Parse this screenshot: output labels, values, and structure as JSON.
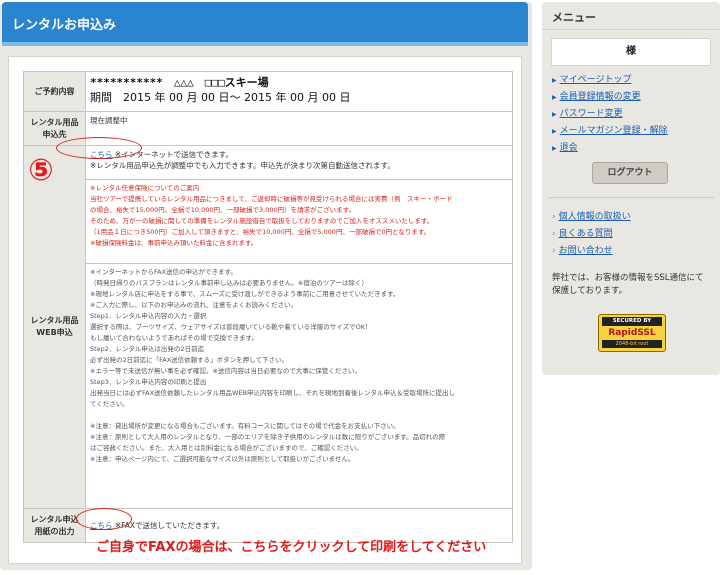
{
  "main": {
    "title": "レンタルお申込み",
    "reservation": {
      "label": "ご予約内容",
      "line1": "***********　△△△　□□□スキー場",
      "line2": "期間　2015 年 00 月 00 日～ 2015 年 00 月 00 日"
    },
    "delivery": {
      "label_1": "レンタル用品",
      "label_2": "申込先",
      "value": "現在調整中"
    },
    "web_apply": {
      "label_1": "レンタル用品",
      "label_2": "WEB申込",
      "link": "こちら",
      "link_after": " ※インターネットで送信できます。",
      "note2": "※レンタル用品申込先が調整中でも入力できます。申込先が決まり次第自動送信されます。",
      "insurance": [
        "※レンタル任意保険についてのご案内",
        "当社ツアーで提携しているレンタル用品につきまして、ご返却時に破損等が見受けられる場合には実費（例　スキー・ボード",
        "の場合、裕失で15,000円、全損で10,000円、一部破損で3,000円）を請求がございます。",
        "そのため、万が一の破損に関しての準備をレンタル施設借自で取扱をしておりますのでご加入をオススメいたします。",
        "（1用品１日につき500円）ご加入して頂きますと、裕失で10,000円、全損で5,000円、一部破損で0円となります。",
        "※破損保険料金は、事前申込み頂いた料金に含まれます。"
      ],
      "instructions": [
        "※インターネットからFAX送信の申込ができます。",
        "（時発日帰りのバスプランはレンタル事前申し込みは必要ありません。※宿泊のツアーは除く）",
        "※現地レンタル店に申込をする事で、スムーズに受け渡しができるよう事前にご用意させていただきます。",
        "※ご入力に際し、以下のお申込みの流れ、注意をよくお読みください。",
        "Step1．レンタル申込内容の入力・選択",
        "選択する際は、ブーツサイズ、ウェアサイズは普段履いている靴や着ている洋服のサイズでOK！",
        "もし履いて合わないようであればその場で交換できます。",
        "Step2．レンタル申込は出発の2日前迄",
        "必ず出発の2日前迄に「FAX送信依頼する」ボタンを押して下さい。",
        "※エラー等で未送信が無い事を必ず確認。※送信内容は当日必要なので大事に保管ください。",
        "Step3．レンタル申込内容の印刷と提出",
        "出発当日には必ずFAX送信依頼したレンタル用品WEB申込内容を印刷し、それを現地到着後レンタル申込＆受取場所に提出し",
        "てください。",
        "",
        "※注意：貸出場所が変更になる場合もございます。有料コースに関してはその場で代金をお支払い下さい。",
        "※注意：原則として大人用のレンタルとなり、一部のエリアを除き子供用のレンタルは数に限りがございます。品切れの際",
        "はご容赦ください。また、大人用とは別料金になる場合がございますので、ご確認ください。",
        "※注意：申込ページ内にて、ご選択可能なサイズ以外は原則として取扱いがございません。"
      ]
    },
    "fax_output": {
      "label_1": "レンタル申込",
      "label_2": "用紙の出力",
      "link": "こちら",
      "text": " ※FAXで送信していただきます。"
    },
    "annotation_number": "⑤",
    "bottom_instruction": "ご自身でFAXの場合は、こちらをクリックして印刷をしてください"
  },
  "sidebar": {
    "title": "メニュー",
    "user": "様",
    "links": [
      "マイページトップ",
      "会員登録情報の変更",
      "パスワード変更",
      "メールマガジン登録・解除",
      "退会"
    ],
    "logout": "ログアウト",
    "links2": [
      "個人情報の取扱い",
      "良くある質問",
      "お問い合わせ"
    ],
    "ssl_text": "弊社では、お客様の情報をSSL通信にて保護しております。",
    "ssl_badge": {
      "line1": "SECURED BY",
      "line2": "RapidSSL",
      "line3": "2048-bit root"
    }
  }
}
